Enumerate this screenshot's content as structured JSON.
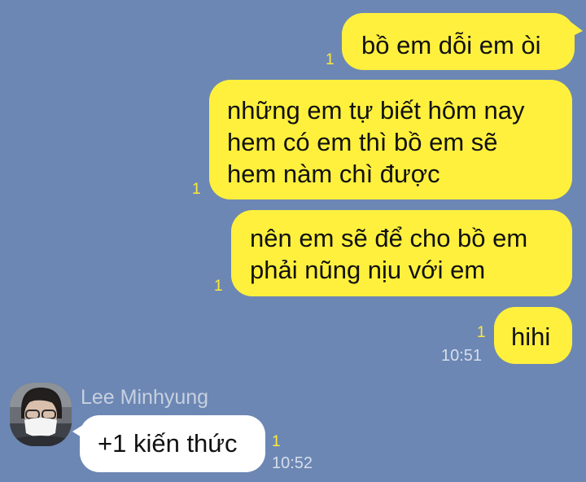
{
  "chat": {
    "background_color": "#6c87b4",
    "outgoing_bubble_color": "#fff03d",
    "read_indicator_color": "#ffe93a",
    "messages_out": [
      {
        "text": "bồ em dỗi em òi",
        "read_count": "1"
      },
      {
        "text": "những em tự biết hôm nay\nhem có em thì bồ em sẽ\nhem nàm chì được",
        "read_count": "1"
      },
      {
        "text": "nên em sẽ để cho bồ em\nphải nũng nịu với em",
        "read_count": "1"
      },
      {
        "text": "hihi",
        "read_count": "1",
        "time": "10:51"
      }
    ],
    "incoming": {
      "sender_name": "Lee Minhyung",
      "avatar_icon": "profile-photo-masked-person",
      "text": "+1 kiến thức",
      "read_count": "1",
      "time": "10:52"
    }
  }
}
